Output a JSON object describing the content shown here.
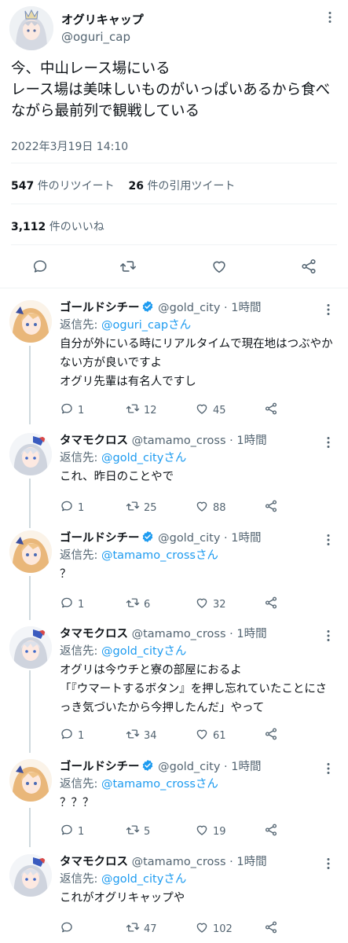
{
  "main_tweet": {
    "display_name": "オグリキャップ",
    "handle": "@oguri_cap",
    "text": "今、中山レース場にいる\nレース場は美味しいものがいっぱいあるから食べながら最前列で観戦している",
    "timestamp": "2022年3月19日 14:10",
    "retweets_count": "547",
    "retweets_label": "件のリツイート",
    "quotes_count": "26",
    "quotes_label": "件の引用ツイート",
    "likes_count": "3,112",
    "likes_label": "件のいいね"
  },
  "icons": {
    "reply": "reply-icon",
    "retweet": "retweet-icon",
    "like": "heart-icon",
    "share": "share-icon",
    "more": "more-icon",
    "verified": "verified-badge-icon"
  },
  "colors": {
    "accent": "#1d9bf0",
    "muted": "#536471",
    "text": "#0f1419",
    "divider": "#eff3f4",
    "thread_line": "#cfd9de"
  },
  "replies": [
    {
      "display_name": "ゴールドシチー",
      "verified": true,
      "handle": "@gold_city",
      "time": "· 1時間",
      "replying_prefix": "返信先: ",
      "replying_to": "@oguri_cap",
      "replying_suffix": "さん",
      "text": "自分が外にいる時にリアルタイムで現在地はつぶやかない方が良いですよ\nオグリ先輩は有名人ですし",
      "reply_count": "1",
      "retweet_count": "12",
      "like_count": "45"
    },
    {
      "display_name": "タマモクロス",
      "verified": false,
      "handle": "@tamamo_cross",
      "time": "· 1時間",
      "replying_prefix": "返信先: ",
      "replying_to": "@gold_city",
      "replying_suffix": "さん",
      "text": "これ、昨日のことやで",
      "reply_count": "1",
      "retweet_count": "25",
      "like_count": "88"
    },
    {
      "display_name": "ゴールドシチー",
      "verified": true,
      "handle": "@gold_city",
      "time": "· 1時間",
      "replying_prefix": "返信先: ",
      "replying_to": "@tamamo_cross",
      "replying_suffix": "さん",
      "text": "？",
      "reply_count": "1",
      "retweet_count": "6",
      "like_count": "32"
    },
    {
      "display_name": "タマモクロス",
      "verified": false,
      "handle": "@tamamo_cross",
      "time": "· 1時間",
      "replying_prefix": "返信先: ",
      "replying_to": "@gold_city",
      "replying_suffix": "さん",
      "text": "オグリは今ウチと寮の部屋におるよ\n「『ウマートするボタン』を押し忘れていたことにさっき気づいたから今押したんだ」やって",
      "reply_count": "1",
      "retweet_count": "34",
      "like_count": "61"
    },
    {
      "display_name": "ゴールドシチー",
      "verified": true,
      "handle": "@gold_city",
      "time": "· 1時間",
      "replying_prefix": "返信先: ",
      "replying_to": "@tamamo_cross",
      "replying_suffix": "さん",
      "text": "？？？",
      "reply_count": "1",
      "retweet_count": "5",
      "like_count": "19"
    },
    {
      "display_name": "タマモクロス",
      "verified": false,
      "handle": "@tamamo_cross",
      "time": "· 1時間",
      "replying_prefix": "返信先: ",
      "replying_to": "@gold_city",
      "replying_suffix": "さん",
      "text": "これがオグリキャップや",
      "reply_count": "",
      "retweet_count": "47",
      "like_count": "102"
    }
  ]
}
